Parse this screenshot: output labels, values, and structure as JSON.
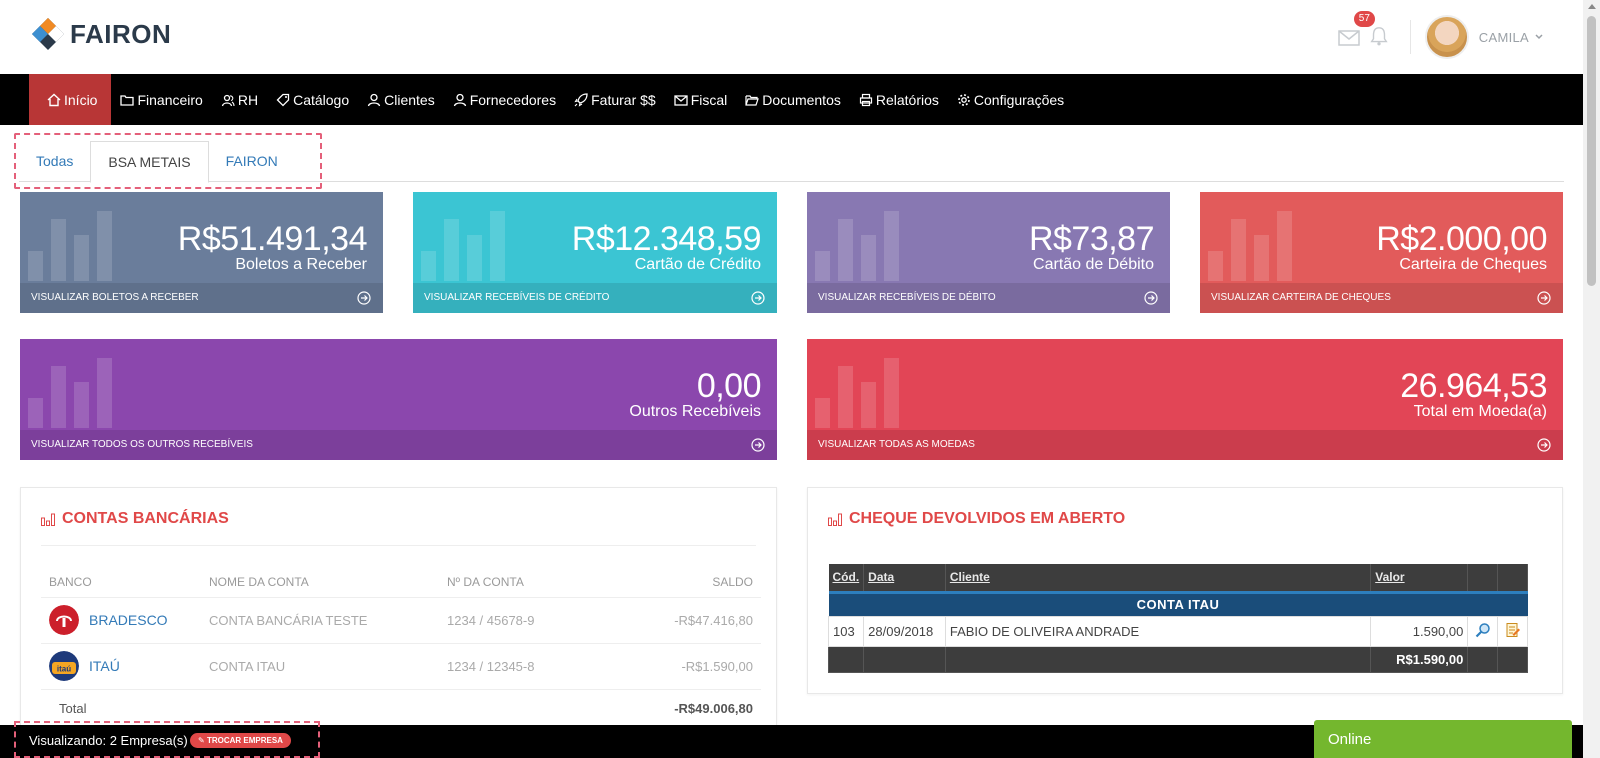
{
  "header": {
    "logo_text": "FAIRON",
    "notification_count": "57",
    "user_name": "CAMILA"
  },
  "nav": {
    "items": [
      {
        "label": "Início",
        "icon": "home-icon"
      },
      {
        "label": "Financeiro",
        "icon": "folder-icon"
      },
      {
        "label": "RH",
        "icon": "users-icon"
      },
      {
        "label": "Catálogo",
        "icon": "tag-icon"
      },
      {
        "label": "Clientes",
        "icon": "user-icon"
      },
      {
        "label": "Fornecedores",
        "icon": "user-icon"
      },
      {
        "label": "Faturar $$",
        "icon": "rocket-icon"
      },
      {
        "label": "Fiscal",
        "icon": "envelope-icon"
      },
      {
        "label": "Documentos",
        "icon": "folder-open-icon"
      },
      {
        "label": "Relatórios",
        "icon": "printer-icon"
      },
      {
        "label": "Configurações",
        "icon": "gear-icon"
      }
    ]
  },
  "tabs": [
    {
      "label": "Todas"
    },
    {
      "label": "BSA METAIS"
    },
    {
      "label": "FAIRON"
    }
  ],
  "stats": [
    {
      "value": "R$51.491,34",
      "label": "Boletos a Receber",
      "link": "VISUALIZAR BOLETOS A RECEBER",
      "color": "#6a7d9b"
    },
    {
      "value": "R$12.348,59",
      "label": "Cartão de Crédito",
      "link": "VISUALIZAR RECEBÍVEIS DE CRÉDITO",
      "color": "#3bc5d3"
    },
    {
      "value": "R$73,87",
      "label": "Cartão de Débito",
      "link": "VISUALIZAR RECEBÍVEIS DE DÉBITO",
      "color": "#8878b2"
    },
    {
      "value": "R$2.000,00",
      "label": "Carteira de Cheques",
      "link": "VISUALIZAR CARTEIRA DE CHEQUES",
      "color": "#e25b5b"
    },
    {
      "value": "0,00",
      "label": "Outros Recebíveis",
      "link": "VISUALIZAR TODOS OS OUTROS RECEBÍVEIS",
      "color": "#8b47ad"
    },
    {
      "value": "26.964,53",
      "label": "Total em Moeda(a)",
      "link": "VISUALIZAR TODAS AS MOEDAS",
      "color": "#e24556"
    }
  ],
  "bank_accounts": {
    "title": "CONTAS BANCÁRIAS",
    "columns": [
      "BANCO",
      "NOME DA CONTA",
      "Nº DA CONTA",
      "SALDO"
    ],
    "rows": [
      {
        "bank": "BRADESCO",
        "account_name": "CONTA BANCÁRIA TESTE",
        "account_no": "1234 / 45678-9",
        "balance": "-R$47.416,80"
      },
      {
        "bank": "ITAÚ",
        "account_name": "CONTA ITAU",
        "account_no": "1234 / 12345-8",
        "balance": "-R$1.590,00"
      }
    ],
    "total_label": "Total",
    "total_value": "-R$49.006,80"
  },
  "returned_checks": {
    "title": "CHEQUE DEVOLVIDOS EM ABERTO",
    "columns": [
      "Cód.",
      "Data",
      "Cliente",
      "Valor"
    ],
    "group": "CONTA ITAU",
    "rows": [
      {
        "code": "103",
        "date": "28/09/2018",
        "client": "FABIO DE OLIVEIRA ANDRADE",
        "value": "1.590,00"
      }
    ],
    "sum": "R$1.590,00"
  },
  "bottom_bar": {
    "viewing": "Visualizando: 2 Empresa(s)",
    "switch_button": "TROCAR EMPRESA",
    "chat": "Online"
  }
}
